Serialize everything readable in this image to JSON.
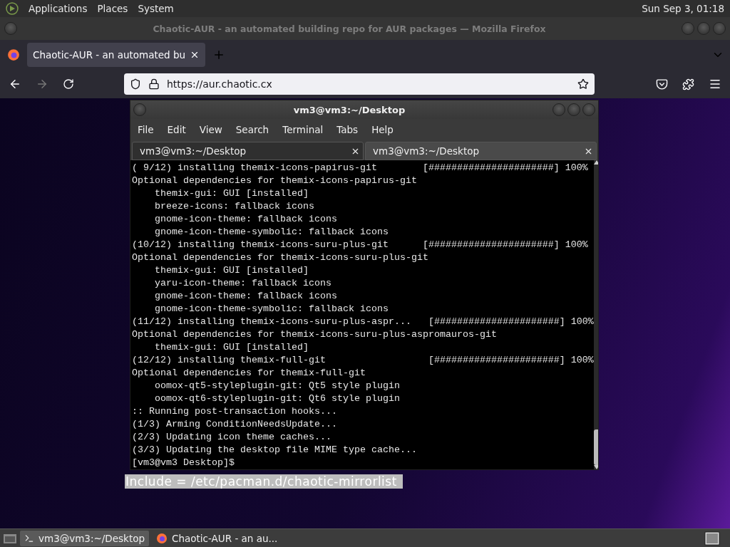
{
  "top_panel": {
    "menus": [
      "Applications",
      "Places",
      "System"
    ],
    "clock": "Sun Sep  3, 01:18"
  },
  "browser": {
    "window_title": "Chaotic-AUR - an automated building repo for AUR packages — Mozilla Firefox",
    "tabs": [
      {
        "label": "Chaotic-AUR - an automated bu",
        "selected": true
      }
    ],
    "url": "https://aur.chaotic.cx",
    "selected_text": "Include = /etc/pacman.d/chaotic-mirrorlist"
  },
  "terminal": {
    "title": "vm3@vm3:~/Desktop",
    "menus": [
      "File",
      "Edit",
      "View",
      "Search",
      "Terminal",
      "Tabs",
      "Help"
    ],
    "tabs": [
      {
        "label": "vm3@vm3:~/Desktop",
        "selected": true
      },
      {
        "label": "vm3@vm3:~/Desktop",
        "selected": false
      }
    ],
    "lines": [
      "( 9/12) installing themix-icons-papirus-git        [######################] 100%",
      "Optional dependencies for themix-icons-papirus-git",
      "    themix-gui: GUI [installed]",
      "    breeze-icons: fallback icons",
      "    gnome-icon-theme: fallback icons",
      "    gnome-icon-theme-symbolic: fallback icons",
      "(10/12) installing themix-icons-suru-plus-git      [######################] 100%",
      "Optional dependencies for themix-icons-suru-plus-git",
      "    themix-gui: GUI [installed]",
      "    yaru-icon-theme: fallback icons",
      "    gnome-icon-theme: fallback icons",
      "    gnome-icon-theme-symbolic: fallback icons",
      "(11/12) installing themix-icons-suru-plus-aspr...   [######################] 100%",
      "Optional dependencies for themix-icons-suru-plus-aspromauros-git",
      "    themix-gui: GUI [installed]",
      "(12/12) installing themix-full-git                  [######################] 100%",
      "Optional dependencies for themix-full-git",
      "    oomox-qt5-styleplugin-git: Qt5 style plugin",
      "    oomox-qt6-styleplugin-git: Qt6 style plugin",
      ":: Running post-transaction hooks...",
      "(1/3) Arming ConditionNeedsUpdate...",
      "(2/3) Updating icon theme caches...",
      "(3/3) Updating the desktop file MIME type cache...",
      "[vm3@vm3 Desktop]$ "
    ]
  },
  "taskbar": {
    "items": [
      {
        "label": "vm3@vm3:~/Desktop",
        "kind": "terminal",
        "selected": true
      },
      {
        "label": "Chaotic-AUR - an au...",
        "kind": "browser",
        "selected": false
      }
    ]
  }
}
